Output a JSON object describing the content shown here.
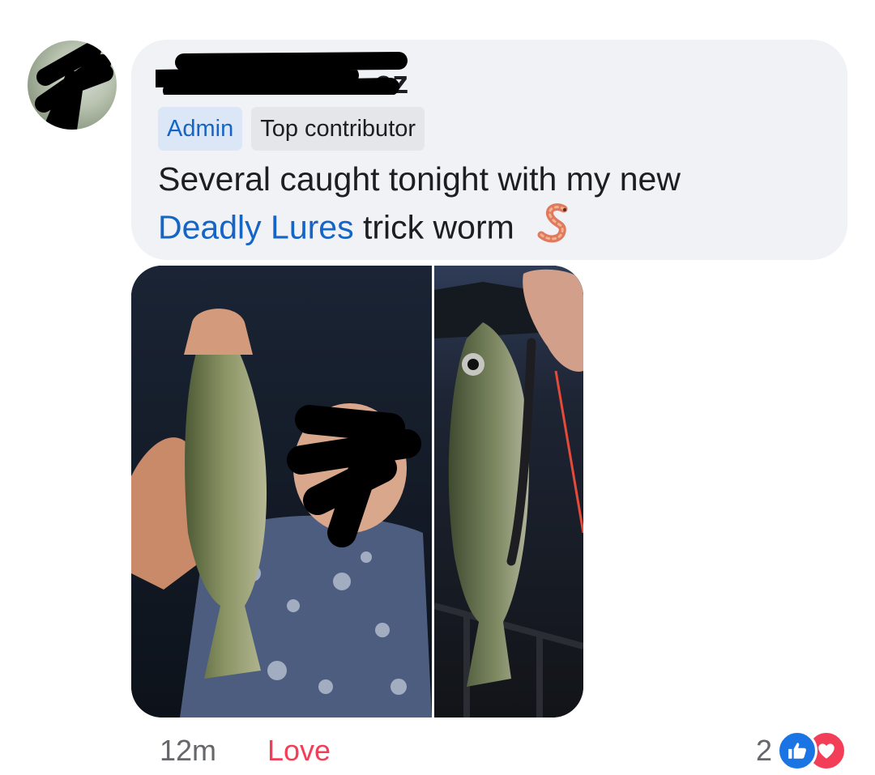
{
  "comment": {
    "author_name_visible": "ez",
    "badges": {
      "admin": "Admin",
      "contributor": "Top contributor"
    },
    "message": {
      "text_line1": "Several caught tonight with my new",
      "link": "Deadly Lures",
      "text_after_link": "trick worm"
    },
    "emoji_icon": "worm-emoji",
    "colors": {
      "link": "#1565c6",
      "love": "#f33e58",
      "like": "#1b74e4",
      "bubble": "#f0f2f5"
    }
  },
  "footer": {
    "time": "12m",
    "love_label": "Love",
    "reaction_count": "2",
    "reaction_icons": [
      "like-icon",
      "love-icon"
    ]
  }
}
